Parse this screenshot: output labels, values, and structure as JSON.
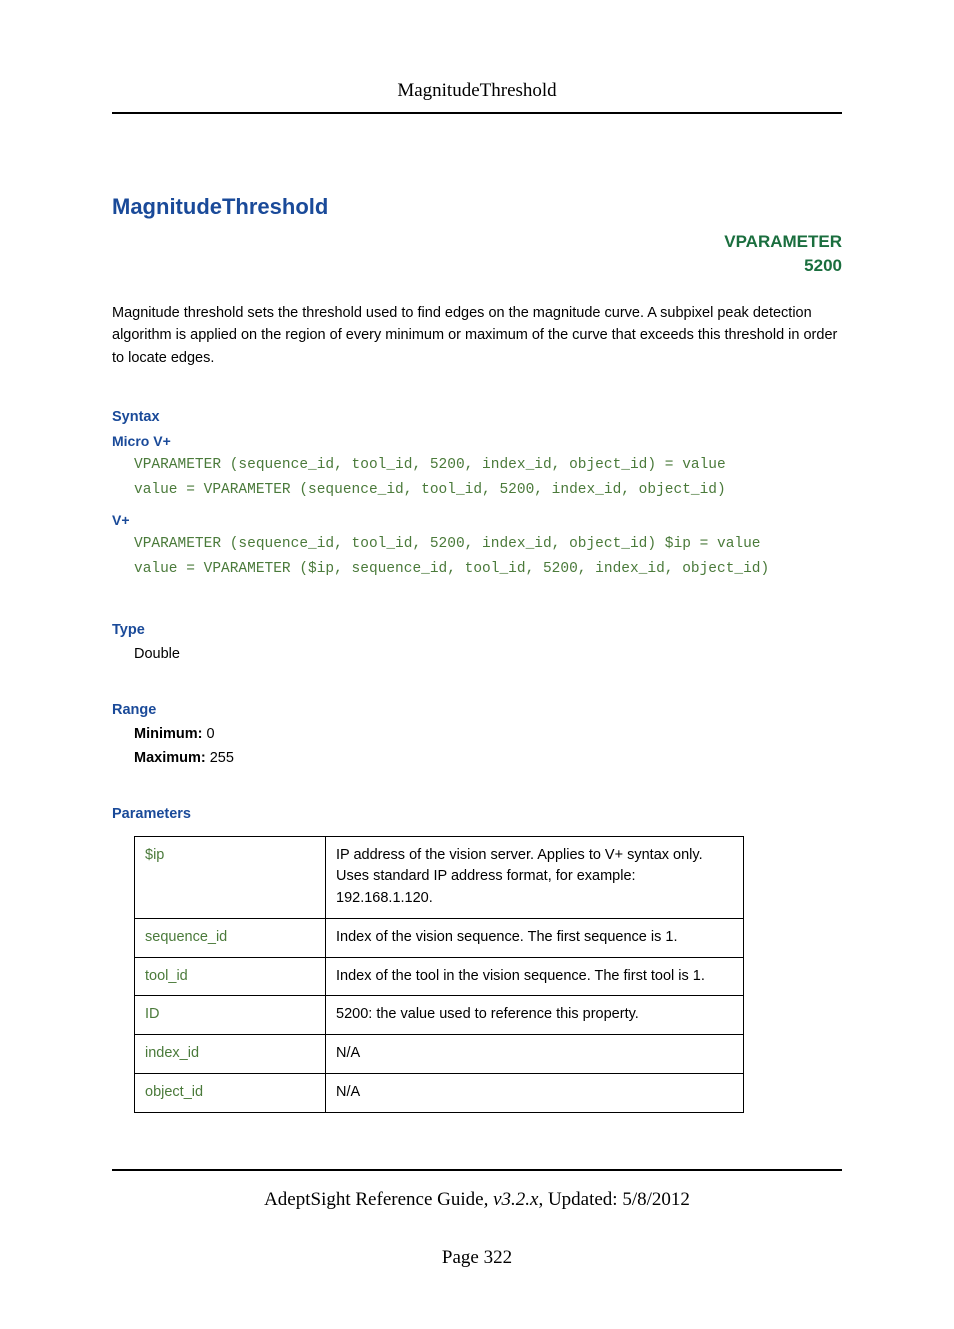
{
  "header": {
    "title": "MagnitudeThreshold"
  },
  "main": {
    "title": "MagnitudeThreshold",
    "vparam_label": "VPARAMETER",
    "vparam_code": "5200",
    "description": "Magnitude threshold sets the threshold used to find edges on the magnitude curve. A subpixel peak detection algorithm is applied on the region of every minimum or maximum of the curve that exceeds this threshold in order to locate edges."
  },
  "syntax": {
    "heading": "Syntax",
    "micro_heading": "Micro V+",
    "micro_code": "VPARAMETER (sequence_id, tool_id, 5200, index_id, object_id) = value\nvalue = VPARAMETER (sequence_id, tool_id, 5200, index_id, object_id)",
    "vplus_heading": "V+",
    "vplus_code": "VPARAMETER (sequence_id, tool_id, 5200, index_id, object_id) $ip = value\nvalue = VPARAMETER ($ip, sequence_id, tool_id, 5200, index_id, object_id)"
  },
  "type": {
    "heading": "Type",
    "value": "Double"
  },
  "range": {
    "heading": "Range",
    "min_label": "Minimum:",
    "min_value": " 0",
    "max_label": "Maximum:",
    "max_value": " 255"
  },
  "parameters": {
    "heading": "Parameters",
    "rows": [
      {
        "name": "$ip",
        "desc": "IP address of the vision server. Applies to V+ syntax only. Uses standard IP address format, for example: 192.168.1.120."
      },
      {
        "name": "sequence_id",
        "desc": "Index of the vision sequence. The first sequence is 1."
      },
      {
        "name": "tool_id",
        "desc": "Index of the tool in the vision sequence. The first tool is 1."
      },
      {
        "name": "ID",
        "desc": "5200: the value used to reference this property."
      },
      {
        "name": "index_id",
        "desc": "N/A"
      },
      {
        "name": "object_id",
        "desc": "N/A"
      }
    ]
  },
  "footer": {
    "guide": "AdeptSight Reference Guide",
    "sep": ", ",
    "version": "v3.2.x",
    "updated_sep": ", Updated: ",
    "date": "5/8/2012",
    "page": "Page 322"
  }
}
